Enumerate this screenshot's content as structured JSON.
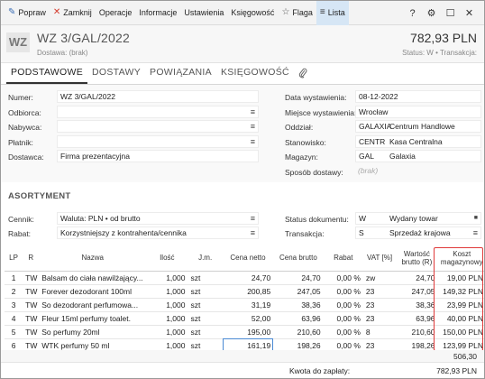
{
  "toolbar": {
    "buttons": [
      {
        "label": "Popraw",
        "icon": "pencil-icon",
        "glyph": "✎",
        "color": "#3a6db5"
      },
      {
        "label": "Zamknij",
        "icon": "close-icon",
        "glyph": "✕",
        "color": "#d33a2c"
      },
      {
        "label": "Operacje"
      },
      {
        "label": "Informacje"
      },
      {
        "label": "Ustawienia"
      },
      {
        "label": "Księgowość"
      },
      {
        "label": "Flaga",
        "icon": "star-icon",
        "glyph": "☆",
        "color": "#555"
      },
      {
        "label": "Lista",
        "icon": "list-icon",
        "glyph": "≡",
        "color": "#333"
      }
    ],
    "right_icons": [
      "help-icon",
      "gear-icon",
      "maximize-icon",
      "close-icon"
    ],
    "right_glyphs": [
      "?",
      "⚙",
      "☐",
      "✕"
    ]
  },
  "header": {
    "badge": "WZ",
    "title": "WZ 3/GAL/2022",
    "subtitle": "Dostawa: (brak)",
    "amount": "782,93 PLN",
    "status": "Status: W  •  Transakcja:"
  },
  "tabs": [
    "PODSTAWOWE",
    "DOSTAWY",
    "POWIĄZANIA",
    "KSIĘGOWOŚĆ"
  ],
  "form": {
    "left": [
      {
        "label": "Numer:",
        "value": "WZ 3/GAL/2022",
        "sel": false
      },
      {
        "label": "Odbiorca:",
        "value": "",
        "sel": true
      },
      {
        "label": "Nabywca:",
        "value": "",
        "sel": true
      },
      {
        "label": "Płatnik:",
        "value": "",
        "sel": true
      },
      {
        "label": "Dostawca:",
        "value": "Firma prezentacyjna",
        "sel": false
      }
    ],
    "right": [
      {
        "label": "Data wystawienia:",
        "code": "",
        "value": "08-12-2022"
      },
      {
        "label": "Miejsce wystawienia:",
        "code": "",
        "value": "Wrocław"
      },
      {
        "label": "Oddział:",
        "code": "GALAXIA",
        "value": "Centrum Handlowe"
      },
      {
        "label": "Stanowisko:",
        "code": "CENTR",
        "value": "Kasa Centralna"
      },
      {
        "label": "Magazyn:",
        "code": "GAL",
        "value": "Galaxia"
      },
      {
        "label": "Sposób dostawy:",
        "code": "",
        "value": "(brak)"
      }
    ]
  },
  "asortyment": {
    "title": "ASORTYMENT",
    "cennik_label": "Cennik:",
    "cennik_value": "Waluta: PLN • od brutto",
    "rabat_label": "Rabat:",
    "rabat_value": "Korzystniejszy z kontrahenta/cennika",
    "status_label": "Status dokumentu:",
    "status_code": "W",
    "status_value": "Wydany towar",
    "transakcja_label": "Transakcja:",
    "transakcja_code": "S",
    "transakcja_value": "Sprzedaż krajowa"
  },
  "table": {
    "headers": [
      "LP",
      "R",
      "Nazwa",
      "Ilość",
      "J.m.",
      "Cena netto",
      "Cena brutto",
      "Rabat",
      "VAT [%]",
      "Wartość brutto (R)",
      "Koszt magazynowy"
    ],
    "rows": [
      [
        "1",
        "TW",
        "Balsam do ciała nawilżający...",
        "1,000",
        "szt",
        "24,70",
        "24,70",
        "0,00 %",
        "zw",
        "24,70",
        "19,00 PLN"
      ],
      [
        "2",
        "TW",
        "Forever dezodorant 100ml",
        "1,000",
        "szt",
        "200,85",
        "247,05",
        "0,00 %",
        "23",
        "247,05",
        "149,32 PLN"
      ],
      [
        "3",
        "TW",
        "So dezodorant perfumowa...",
        "1,000",
        "szt",
        "31,19",
        "38,36",
        "0,00 %",
        "23",
        "38,36",
        "23,99 PLN"
      ],
      [
        "4",
        "TW",
        "Fleur 15ml perfumy toalet.",
        "1,000",
        "szt",
        "52,00",
        "63,96",
        "0,00 %",
        "23",
        "63,96",
        "40,00 PLN"
      ],
      [
        "5",
        "TW",
        "So perfumy 20ml",
        "1,000",
        "szt",
        "195,00",
        "210,60",
        "0,00 %",
        "8",
        "210,60",
        "150,00 PLN"
      ],
      [
        "6",
        "TW",
        "WTK perfumy 50 ml",
        "1,000",
        "szt",
        "161,19",
        "198,26",
        "0,00 %",
        "23",
        "198,26",
        "123,99 PLN"
      ]
    ],
    "sum": "506,30"
  },
  "footer": {
    "pay_label": "Kwota do zapłaty:",
    "pay_value": "782,93 PLN"
  },
  "colors": {
    "highlight": "#e03a3a",
    "selection": "#4a8ad4",
    "active_tab_bg": "#d6e6f5"
  }
}
